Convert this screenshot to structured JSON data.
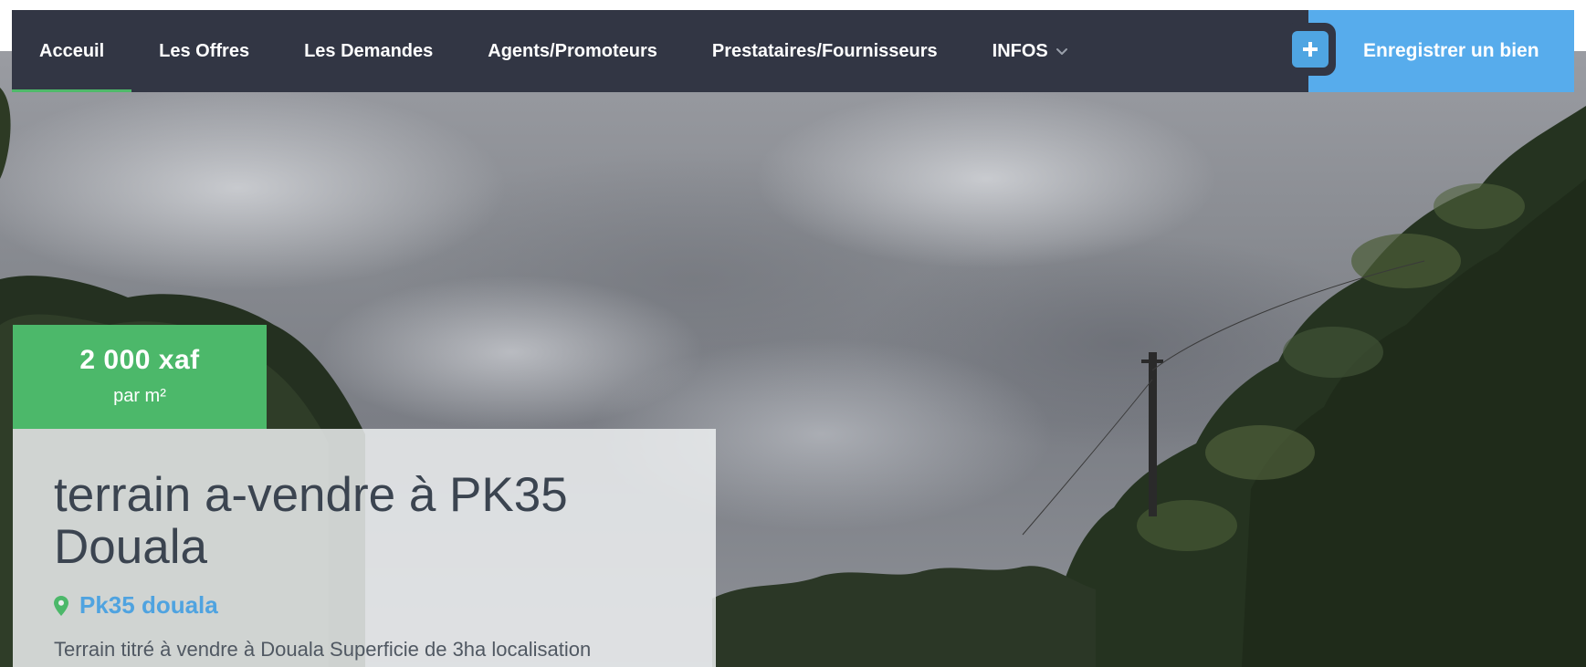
{
  "nav": {
    "items": [
      {
        "label": "Acceuil",
        "active": true
      },
      {
        "label": "Les Offres",
        "active": false
      },
      {
        "label": "Les Demandes",
        "active": false
      },
      {
        "label": "Agents/Promoteurs",
        "active": false
      },
      {
        "label": "Prestataires/Fournisseurs",
        "active": false
      },
      {
        "label": "INFOS",
        "active": false,
        "has_dropdown": true
      }
    ],
    "register_label": "Enregistrer un bien",
    "register_icon": "plus-icon",
    "dropdown_icon": "chevron-down-icon"
  },
  "listing": {
    "price": "2 000 xaf",
    "price_unit": "par m²",
    "title": "terrain a-vendre à PK35 Douala",
    "location": "Pk35 douala",
    "location_icon": "map-pin-icon",
    "description": "Terrain titré à vendre à Douala Superficie de 3ha localisation"
  },
  "colors": {
    "nav_bg": "#323644",
    "active_underline": "#4fb96a",
    "register_bg": "#57acec",
    "price_badge_bg": "#4cb86a",
    "location_text": "#4fa3e0",
    "title_text": "#3b4450"
  }
}
